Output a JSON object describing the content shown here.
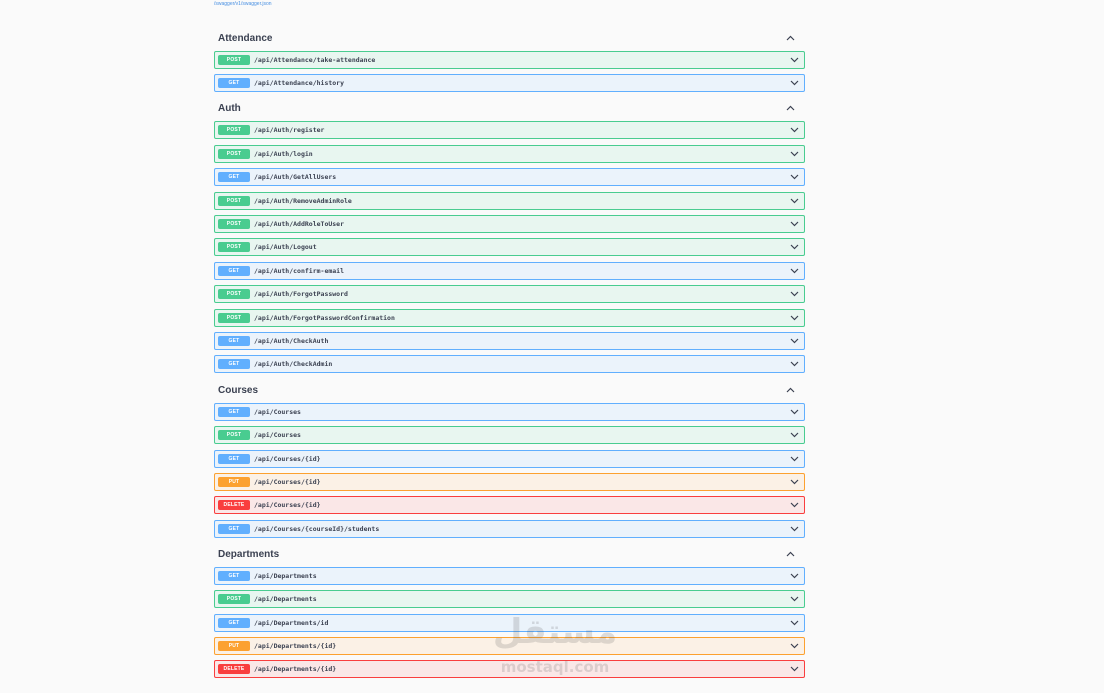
{
  "spec_link": "/swagger/v1/swagger.json",
  "badges": {
    "post": "POST",
    "get": "GET",
    "put": "PUT",
    "delete": "DELETE"
  },
  "colors": {
    "post": "#49cc90",
    "get": "#61affe",
    "put": "#fca130",
    "delete": "#f93e3e"
  },
  "icons": {
    "tag_collapse": "chevron-up-icon",
    "op_expand": "chevron-down-icon"
  },
  "tags": [
    {
      "name": "Attendance",
      "operations": [
        {
          "method": "post",
          "path": "/api/Attendance/take-attendance"
        },
        {
          "method": "get",
          "path": "/api/Attendance/history"
        }
      ]
    },
    {
      "name": "Auth",
      "operations": [
        {
          "method": "post",
          "path": "/api/Auth/register"
        },
        {
          "method": "post",
          "path": "/api/Auth/login"
        },
        {
          "method": "get",
          "path": "/api/Auth/GetAllUsers"
        },
        {
          "method": "post",
          "path": "/api/Auth/RemoveAdminRole"
        },
        {
          "method": "post",
          "path": "/api/Auth/AddRoleToUser"
        },
        {
          "method": "post",
          "path": "/api/Auth/Logout"
        },
        {
          "method": "get",
          "path": "/api/Auth/confirm-email"
        },
        {
          "method": "post",
          "path": "/api/Auth/ForgotPassword"
        },
        {
          "method": "post",
          "path": "/api/Auth/ForgotPasswordConfirmation"
        },
        {
          "method": "get",
          "path": "/api/Auth/CheckAuth"
        },
        {
          "method": "get",
          "path": "/api/Auth/CheckAdmin"
        }
      ]
    },
    {
      "name": "Courses",
      "operations": [
        {
          "method": "get",
          "path": "/api/Courses"
        },
        {
          "method": "post",
          "path": "/api/Courses"
        },
        {
          "method": "get",
          "path": "/api/Courses/{id}"
        },
        {
          "method": "put",
          "path": "/api/Courses/{id}"
        },
        {
          "method": "delete",
          "path": "/api/Courses/{id}"
        },
        {
          "method": "get",
          "path": "/api/Courses/{courseId}/students"
        }
      ]
    },
    {
      "name": "Departments",
      "operations": [
        {
          "method": "get",
          "path": "/api/Departments"
        },
        {
          "method": "post",
          "path": "/api/Departments"
        },
        {
          "method": "get",
          "path": "/api/Departments/id"
        },
        {
          "method": "put",
          "path": "/api/Departments/{id}"
        },
        {
          "method": "delete",
          "path": "/api/Departments/{id}"
        }
      ]
    }
  ],
  "watermark": {
    "word": "مستقل",
    "domain": "mostaql.com"
  }
}
